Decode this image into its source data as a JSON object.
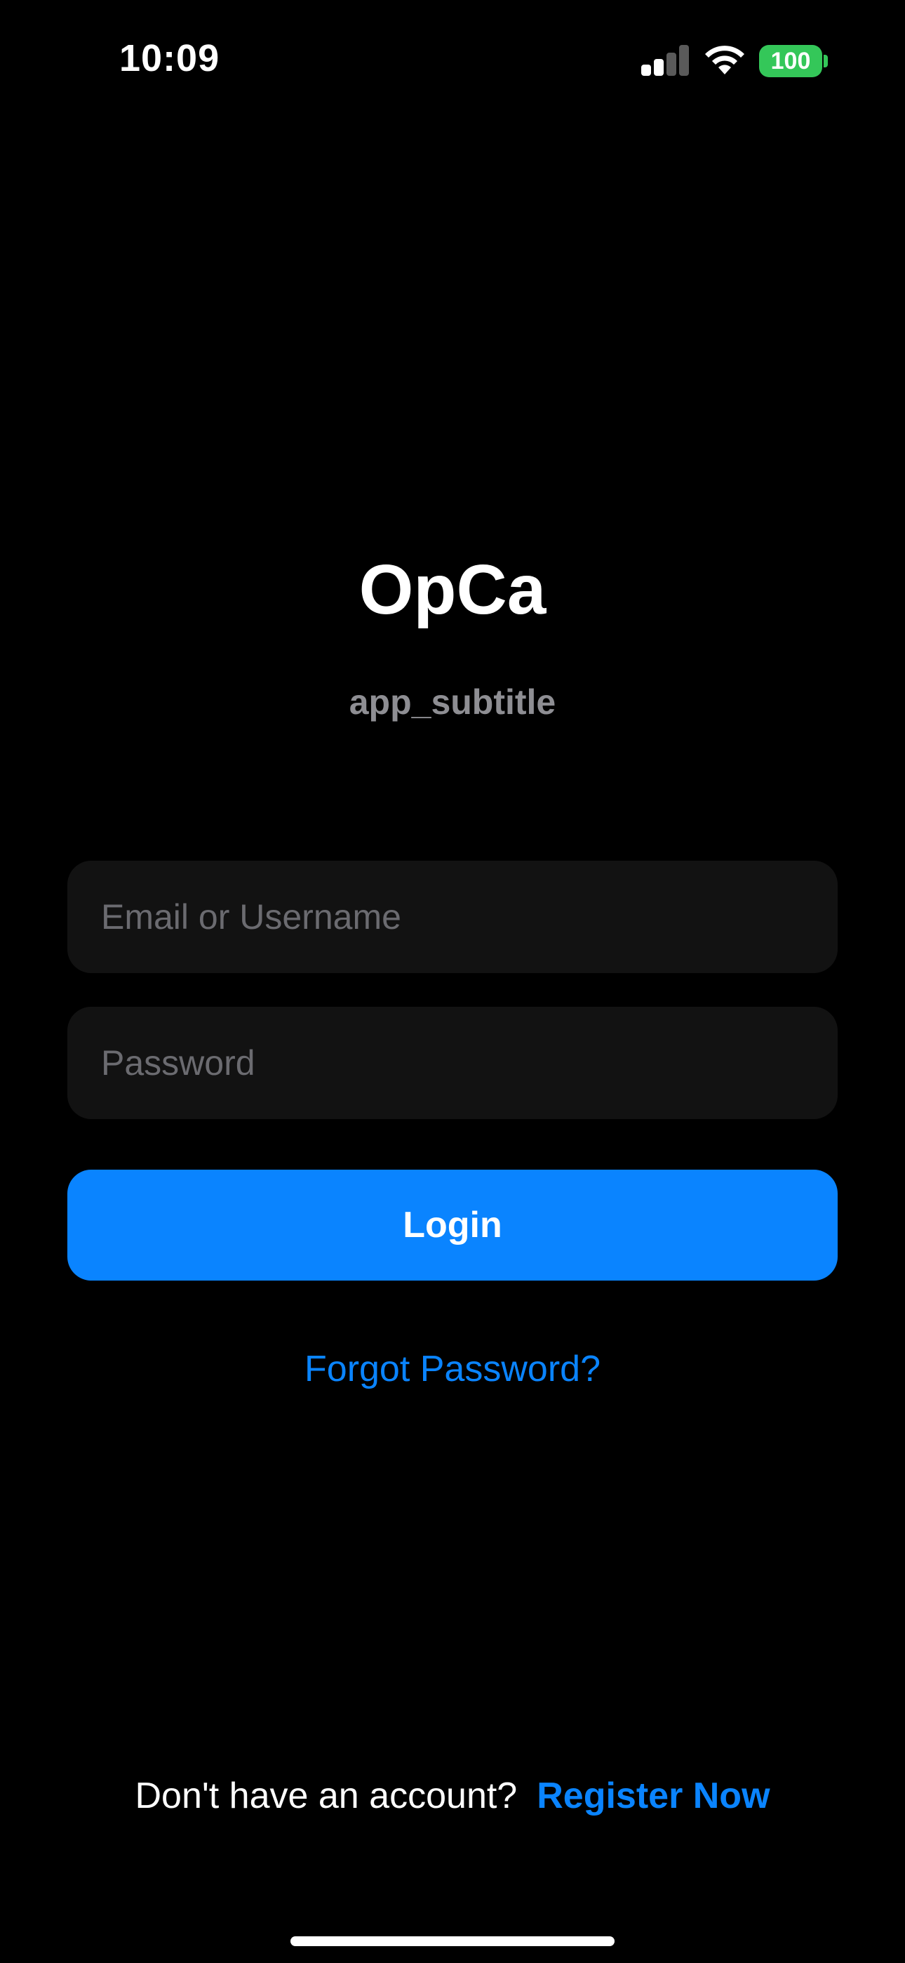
{
  "status_bar": {
    "time": "10:09",
    "battery_level": "100",
    "signal_bars_active": 2,
    "signal_bars_total": 4,
    "icons": [
      "cellular-signal-icon",
      "wifi-icon",
      "battery-icon"
    ],
    "battery_color": "#34c759"
  },
  "header": {
    "title": "OpCa",
    "subtitle": "app_subtitle"
  },
  "form": {
    "email_placeholder": "Email or Username",
    "email_value": "",
    "password_placeholder": "Password",
    "password_value": "",
    "login_label": "Login",
    "forgot_label": "Forgot Password?"
  },
  "footer": {
    "prompt": "Don't have an account?",
    "register_label": "Register Now"
  },
  "colors": {
    "background": "#000000",
    "accent": "#0a84ff",
    "field_background": "#121212",
    "subtitle": "#8e8e93"
  }
}
